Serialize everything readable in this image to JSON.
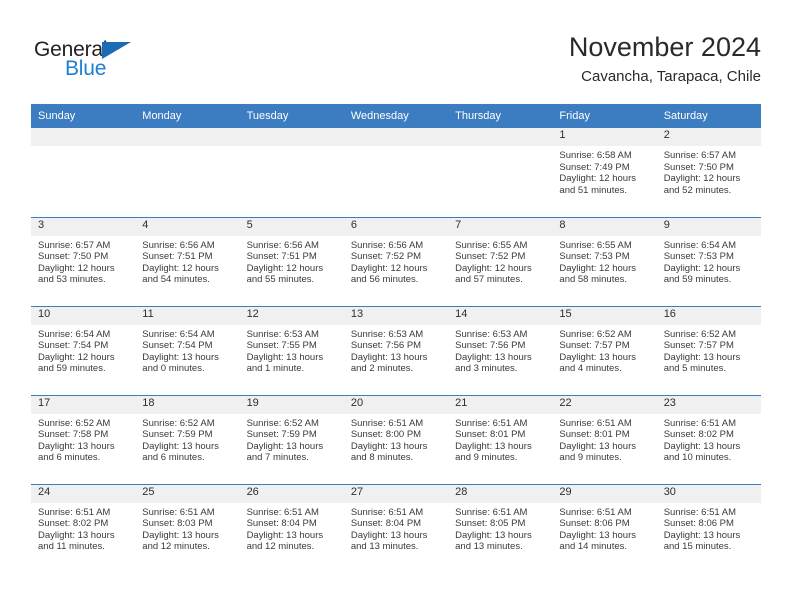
{
  "brand": {
    "name_top": "General",
    "name_bottom": "Blue",
    "accent_color": "#1b7fd4",
    "triangle_color": "#1b6cb5"
  },
  "header": {
    "month_title": "November 2024",
    "location": "Cavancha, Tarapaca, Chile"
  },
  "calendar": {
    "header_bg": "#3b7dc0",
    "daynum_bg": "#f0f0f0",
    "weekday_headers": [
      "Sunday",
      "Monday",
      "Tuesday",
      "Wednesday",
      "Thursday",
      "Friday",
      "Saturday"
    ],
    "weeks": [
      [
        {
          "day": "",
          "sunrise": "",
          "sunset": "",
          "daylight_line1": "",
          "daylight_line2": ""
        },
        {
          "day": "",
          "sunrise": "",
          "sunset": "",
          "daylight_line1": "",
          "daylight_line2": ""
        },
        {
          "day": "",
          "sunrise": "",
          "sunset": "",
          "daylight_line1": "",
          "daylight_line2": ""
        },
        {
          "day": "",
          "sunrise": "",
          "sunset": "",
          "daylight_line1": "",
          "daylight_line2": ""
        },
        {
          "day": "",
          "sunrise": "",
          "sunset": "",
          "daylight_line1": "",
          "daylight_line2": ""
        },
        {
          "day": "1",
          "sunrise": "Sunrise: 6:58 AM",
          "sunset": "Sunset: 7:49 PM",
          "daylight_line1": "Daylight: 12 hours",
          "daylight_line2": "and 51 minutes."
        },
        {
          "day": "2",
          "sunrise": "Sunrise: 6:57 AM",
          "sunset": "Sunset: 7:50 PM",
          "daylight_line1": "Daylight: 12 hours",
          "daylight_line2": "and 52 minutes."
        }
      ],
      [
        {
          "day": "3",
          "sunrise": "Sunrise: 6:57 AM",
          "sunset": "Sunset: 7:50 PM",
          "daylight_line1": "Daylight: 12 hours",
          "daylight_line2": "and 53 minutes."
        },
        {
          "day": "4",
          "sunrise": "Sunrise: 6:56 AM",
          "sunset": "Sunset: 7:51 PM",
          "daylight_line1": "Daylight: 12 hours",
          "daylight_line2": "and 54 minutes."
        },
        {
          "day": "5",
          "sunrise": "Sunrise: 6:56 AM",
          "sunset": "Sunset: 7:51 PM",
          "daylight_line1": "Daylight: 12 hours",
          "daylight_line2": "and 55 minutes."
        },
        {
          "day": "6",
          "sunrise": "Sunrise: 6:56 AM",
          "sunset": "Sunset: 7:52 PM",
          "daylight_line1": "Daylight: 12 hours",
          "daylight_line2": "and 56 minutes."
        },
        {
          "day": "7",
          "sunrise": "Sunrise: 6:55 AM",
          "sunset": "Sunset: 7:52 PM",
          "daylight_line1": "Daylight: 12 hours",
          "daylight_line2": "and 57 minutes."
        },
        {
          "day": "8",
          "sunrise": "Sunrise: 6:55 AM",
          "sunset": "Sunset: 7:53 PM",
          "daylight_line1": "Daylight: 12 hours",
          "daylight_line2": "and 58 minutes."
        },
        {
          "day": "9",
          "sunrise": "Sunrise: 6:54 AM",
          "sunset": "Sunset: 7:53 PM",
          "daylight_line1": "Daylight: 12 hours",
          "daylight_line2": "and 59 minutes."
        }
      ],
      [
        {
          "day": "10",
          "sunrise": "Sunrise: 6:54 AM",
          "sunset": "Sunset: 7:54 PM",
          "daylight_line1": "Daylight: 12 hours",
          "daylight_line2": "and 59 minutes."
        },
        {
          "day": "11",
          "sunrise": "Sunrise: 6:54 AM",
          "sunset": "Sunset: 7:54 PM",
          "daylight_line1": "Daylight: 13 hours",
          "daylight_line2": "and 0 minutes."
        },
        {
          "day": "12",
          "sunrise": "Sunrise: 6:53 AM",
          "sunset": "Sunset: 7:55 PM",
          "daylight_line1": "Daylight: 13 hours",
          "daylight_line2": "and 1 minute."
        },
        {
          "day": "13",
          "sunrise": "Sunrise: 6:53 AM",
          "sunset": "Sunset: 7:56 PM",
          "daylight_line1": "Daylight: 13 hours",
          "daylight_line2": "and 2 minutes."
        },
        {
          "day": "14",
          "sunrise": "Sunrise: 6:53 AM",
          "sunset": "Sunset: 7:56 PM",
          "daylight_line1": "Daylight: 13 hours",
          "daylight_line2": "and 3 minutes."
        },
        {
          "day": "15",
          "sunrise": "Sunrise: 6:52 AM",
          "sunset": "Sunset: 7:57 PM",
          "daylight_line1": "Daylight: 13 hours",
          "daylight_line2": "and 4 minutes."
        },
        {
          "day": "16",
          "sunrise": "Sunrise: 6:52 AM",
          "sunset": "Sunset: 7:57 PM",
          "daylight_line1": "Daylight: 13 hours",
          "daylight_line2": "and 5 minutes."
        }
      ],
      [
        {
          "day": "17",
          "sunrise": "Sunrise: 6:52 AM",
          "sunset": "Sunset: 7:58 PM",
          "daylight_line1": "Daylight: 13 hours",
          "daylight_line2": "and 6 minutes."
        },
        {
          "day": "18",
          "sunrise": "Sunrise: 6:52 AM",
          "sunset": "Sunset: 7:59 PM",
          "daylight_line1": "Daylight: 13 hours",
          "daylight_line2": "and 6 minutes."
        },
        {
          "day": "19",
          "sunrise": "Sunrise: 6:52 AM",
          "sunset": "Sunset: 7:59 PM",
          "daylight_line1": "Daylight: 13 hours",
          "daylight_line2": "and 7 minutes."
        },
        {
          "day": "20",
          "sunrise": "Sunrise: 6:51 AM",
          "sunset": "Sunset: 8:00 PM",
          "daylight_line1": "Daylight: 13 hours",
          "daylight_line2": "and 8 minutes."
        },
        {
          "day": "21",
          "sunrise": "Sunrise: 6:51 AM",
          "sunset": "Sunset: 8:01 PM",
          "daylight_line1": "Daylight: 13 hours",
          "daylight_line2": "and 9 minutes."
        },
        {
          "day": "22",
          "sunrise": "Sunrise: 6:51 AM",
          "sunset": "Sunset: 8:01 PM",
          "daylight_line1": "Daylight: 13 hours",
          "daylight_line2": "and 9 minutes."
        },
        {
          "day": "23",
          "sunrise": "Sunrise: 6:51 AM",
          "sunset": "Sunset: 8:02 PM",
          "daylight_line1": "Daylight: 13 hours",
          "daylight_line2": "and 10 minutes."
        }
      ],
      [
        {
          "day": "24",
          "sunrise": "Sunrise: 6:51 AM",
          "sunset": "Sunset: 8:02 PM",
          "daylight_line1": "Daylight: 13 hours",
          "daylight_line2": "and 11 minutes."
        },
        {
          "day": "25",
          "sunrise": "Sunrise: 6:51 AM",
          "sunset": "Sunset: 8:03 PM",
          "daylight_line1": "Daylight: 13 hours",
          "daylight_line2": "and 12 minutes."
        },
        {
          "day": "26",
          "sunrise": "Sunrise: 6:51 AM",
          "sunset": "Sunset: 8:04 PM",
          "daylight_line1": "Daylight: 13 hours",
          "daylight_line2": "and 12 minutes."
        },
        {
          "day": "27",
          "sunrise": "Sunrise: 6:51 AM",
          "sunset": "Sunset: 8:04 PM",
          "daylight_line1": "Daylight: 13 hours",
          "daylight_line2": "and 13 minutes."
        },
        {
          "day": "28",
          "sunrise": "Sunrise: 6:51 AM",
          "sunset": "Sunset: 8:05 PM",
          "daylight_line1": "Daylight: 13 hours",
          "daylight_line2": "and 13 minutes."
        },
        {
          "day": "29",
          "sunrise": "Sunrise: 6:51 AM",
          "sunset": "Sunset: 8:06 PM",
          "daylight_line1": "Daylight: 13 hours",
          "daylight_line2": "and 14 minutes."
        },
        {
          "day": "30",
          "sunrise": "Sunrise: 6:51 AM",
          "sunset": "Sunset: 8:06 PM",
          "daylight_line1": "Daylight: 13 hours",
          "daylight_line2": "and 15 minutes."
        }
      ]
    ]
  }
}
